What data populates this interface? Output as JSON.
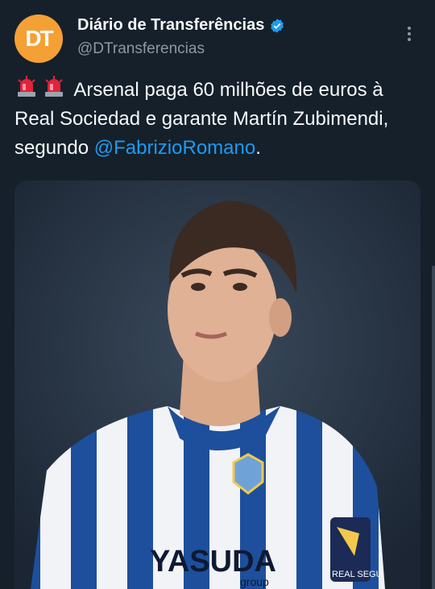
{
  "tweet": {
    "display_name": "Diário de Transferências",
    "handle": "@DTransferencias",
    "avatar_text": "DT",
    "verified": true,
    "text_before": "Arsenal paga 60 milhões de euros à Real Sociedad e garante Martín Zubimendi, segundo ",
    "mention": "@FabrizioRomano",
    "text_after": ".",
    "emojis": [
      "police-light-icon",
      "police-light-icon"
    ]
  },
  "media": {
    "kit_sponsor": "YASUDA",
    "kit_sponsor_sub": "group",
    "sleeve_badge": "REAL SEGU"
  },
  "colors": {
    "background": "#15202b",
    "accent": "#1d9bf0",
    "avatar": "#f5a035",
    "muted": "#8b98a5"
  }
}
